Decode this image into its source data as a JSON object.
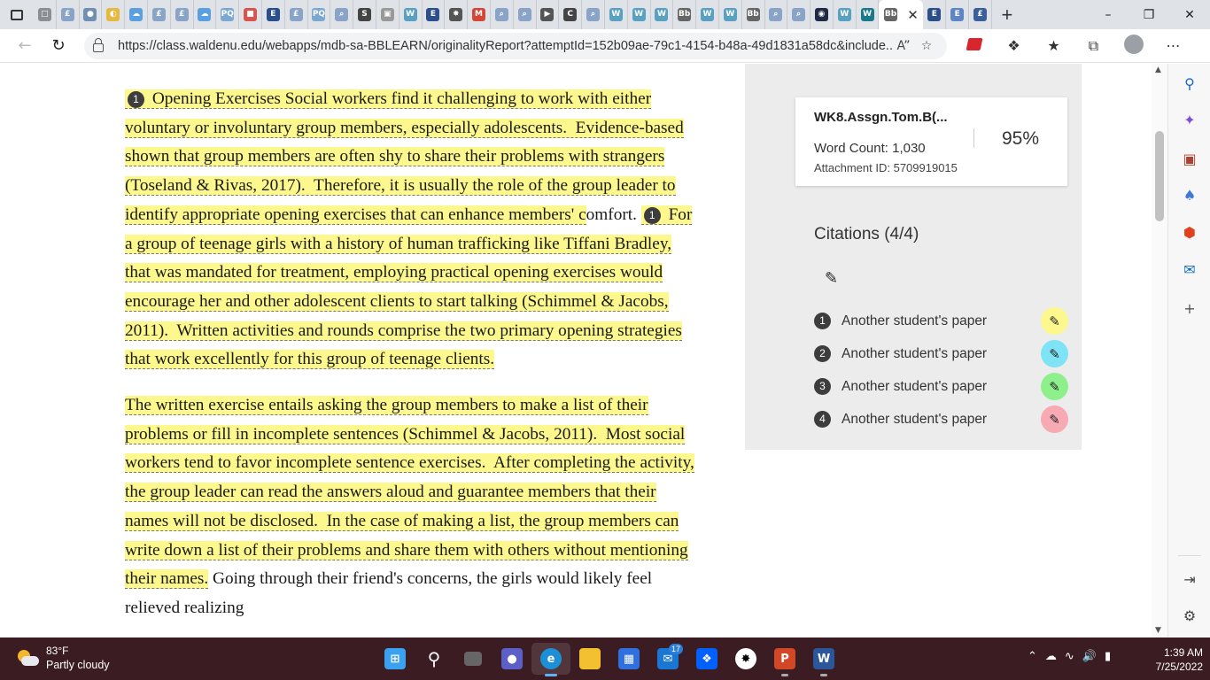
{
  "browser": {
    "tabs": [
      {
        "icon": "page-icon",
        "glyph": "□",
        "color": "#8a8f95"
      },
      {
        "icon": "edge-page-icon",
        "glyph": "£",
        "color": "#8aa4c8"
      },
      {
        "icon": "globe-icon",
        "glyph": "●",
        "color": "#6f8fb3"
      },
      {
        "icon": "chrome-icon",
        "glyph": "◐",
        "color": "#e4b93e"
      },
      {
        "icon": "cloud-icon",
        "glyph": "☁",
        "color": "#5aa0e0"
      },
      {
        "icon": "edge-page-icon",
        "glyph": "£",
        "color": "#8aa4c8"
      },
      {
        "icon": "edge-page-icon",
        "glyph": "£",
        "color": "#8aa4c8"
      },
      {
        "icon": "cloud-icon",
        "glyph": "☁",
        "color": "#5aa0e0"
      },
      {
        "icon": "proquest-icon",
        "glyph": "PQ",
        "color": "#7ba7d0"
      },
      {
        "icon": "pdf-icon",
        "glyph": "■",
        "color": "#d9534f"
      },
      {
        "icon": "ebsco-icon",
        "glyph": "E",
        "color": "#2a4f8a"
      },
      {
        "icon": "edge-page-icon",
        "glyph": "£",
        "color": "#8aa4c8"
      },
      {
        "icon": "proquest-icon",
        "glyph": "PQ",
        "color": "#7ba7d0"
      },
      {
        "icon": "search-icon",
        "glyph": "⌕",
        "color": "#8aa4c8"
      },
      {
        "icon": "scribd-icon",
        "glyph": "S",
        "color": "#444"
      },
      {
        "icon": "image-icon",
        "glyph": "▣",
        "color": "#999"
      },
      {
        "icon": "wikipedia-icon",
        "glyph": "W",
        "color": "#5aa0c0"
      },
      {
        "icon": "ebsco-icon",
        "glyph": "E",
        "color": "#2a4f8a"
      },
      {
        "icon": "openai-icon",
        "glyph": "✸",
        "color": "#555"
      },
      {
        "icon": "gmail-icon",
        "glyph": "M",
        "color": "#d44638"
      },
      {
        "icon": "search-icon",
        "glyph": "⌕",
        "color": "#8aa4c8"
      },
      {
        "icon": "search-icon",
        "glyph": "⌕",
        "color": "#8aa4c8"
      },
      {
        "icon": "arrow-icon",
        "glyph": "▶",
        "color": "#555"
      },
      {
        "icon": "chegg-icon",
        "glyph": "C",
        "color": "#444"
      },
      {
        "icon": "search-icon",
        "glyph": "⌕",
        "color": "#8aa4c8"
      },
      {
        "icon": "wikipedia-icon",
        "glyph": "W",
        "color": "#5aa0c0"
      },
      {
        "icon": "wikipedia-icon",
        "glyph": "W",
        "color": "#5aa0c0"
      },
      {
        "icon": "wikipedia-icon",
        "glyph": "W",
        "color": "#5aa0c0"
      },
      {
        "icon": "blackboard-icon",
        "glyph": "Bb",
        "color": "#666"
      },
      {
        "icon": "wikipedia-icon",
        "glyph": "W",
        "color": "#5aa0c0"
      },
      {
        "icon": "wikipedia-icon",
        "glyph": "W",
        "color": "#5aa0c0"
      },
      {
        "icon": "blackboard-icon",
        "glyph": "Bb",
        "color": "#666"
      },
      {
        "icon": "search-icon",
        "glyph": "⌕",
        "color": "#8aa4c8"
      },
      {
        "icon": "search-icon",
        "glyph": "⌕",
        "color": "#8aa4c8"
      },
      {
        "icon": "walden-icon",
        "glyph": "◉",
        "color": "#1f2a44"
      },
      {
        "icon": "wikipedia-icon",
        "glyph": "W",
        "color": "#5aa0c0"
      },
      {
        "icon": "wikipedia-icon",
        "glyph": "W",
        "color": "#1a7a8a"
      }
    ],
    "active_tab": {
      "icon": "blackboard-icon",
      "glyph": "Bb",
      "color": "#666",
      "close": "✕"
    },
    "tabs_after": [
      {
        "icon": "ebsco-icon",
        "glyph": "E",
        "color": "#2a4f8a"
      },
      {
        "icon": "ebsco-icon",
        "glyph": "E",
        "color": "#5f86c4"
      },
      {
        "icon": "edge-page-icon",
        "glyph": "£",
        "color": "#3a5f9a"
      }
    ],
    "new_tab": "+",
    "url": "https://class.waldenu.edu/webapps/mdb-sa-BBLEARN/originalityReport?attemptId=152b09ae-79c1-4154-b48a-49d1831a58dc&include..."
  },
  "paper": {
    "citation_marker": "1",
    "p1_part1": " Opening Exercises Social workers find it challenging to work with either voluntary or involuntary group members, especially adolescents.  Evidence-based shown that group members are often shy to share their problems with strangers (Toseland & Rivas, 2017).  Therefore, it is usually the role of the group leader to identify appropriate opening exercises that can enhance members' c",
    "p1_plain": "omfort. ",
    "p1_part2": " For a group of teenage girls with a history of human trafficking like Tiffani Bradley, that was mandated for treatment, employing practical opening exercises would encourage her and other adolescent clients to start talking (Schimmel & Jacobs, 2011).  Written activities and rounds comprise the two primary opening strategies that work excellently for this group of teenage clients.",
    "p2_highlight": " The written exercise entails asking the group members to make a list of their problems or fill in incomplete sentences (Schimmel & Jacobs, 2011).  Most social workers tend to favor incomplete sentence exercises.  After completing the activity, the group leader can read the answers aloud and guarantee members that their names will not be disclosed.  In the case of making a list, the group members can write down a list of their problems and share them with others without mentioning their names.",
    "p2_plain": " Going through their friend's concerns, the girls would likely feel relieved realizing"
  },
  "report": {
    "title": "WK8.Assgn.Tom.B(...",
    "word_count": "Word Count: 1,030",
    "attachment_id": "Attachment ID: 5709919015",
    "similarity": "95%"
  },
  "citations": {
    "heading": "Citations (4/4)",
    "items": [
      {
        "number": "1",
        "label": "Another student's paper",
        "color": "#fcf88d"
      },
      {
        "number": "2",
        "label": "Another student's paper",
        "color": "#7de3f5"
      },
      {
        "number": "3",
        "label": "Another student's paper",
        "color": "#8ef08a"
      },
      {
        "number": "4",
        "label": "Another student's paper",
        "color": "#f7a9b4"
      }
    ]
  },
  "taskbar": {
    "temperature": "83°F",
    "weather": "Partly cloudy",
    "mail_badge": "17",
    "time": "1:39 AM",
    "date": "7/25/2022"
  }
}
